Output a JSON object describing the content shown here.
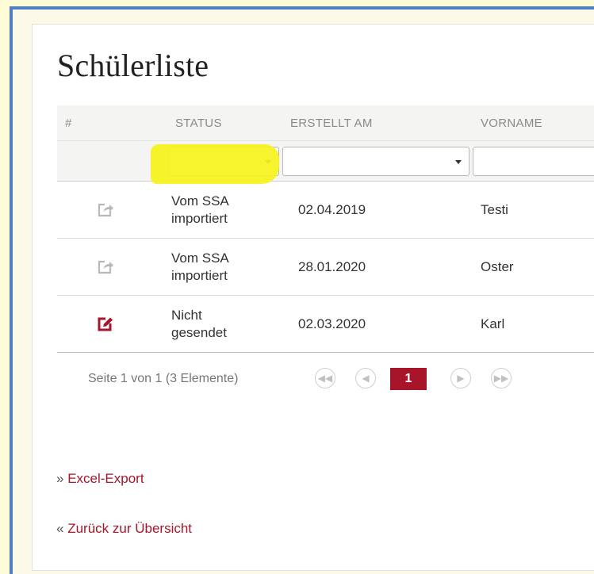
{
  "page": {
    "title": "Schülerliste"
  },
  "table": {
    "columns": [
      "#",
      "STATUS",
      "ERSTELLT AM",
      "VORNAME"
    ],
    "rows": [
      {
        "icon": "share-icon",
        "status_line1": "Vom SSA",
        "status_line2": "importiert",
        "created": "02.04.2019",
        "firstname": "Testi"
      },
      {
        "icon": "share-icon",
        "status_line1": "Vom SSA",
        "status_line2": "importiert",
        "created": "28.01.2020",
        "firstname": "Oster"
      },
      {
        "icon": "edit-icon",
        "status_line1": "Nicht",
        "status_line2": "gesendet",
        "created": "02.03.2020",
        "firstname": "Karl"
      }
    ]
  },
  "pager": {
    "info": "Seite 1 von 1 (3 Elemente)",
    "current_page": "1",
    "first_icon": "first-page-icon",
    "prev_icon": "prev-page-icon",
    "next_icon": "next-page-icon",
    "last_icon": "last-page-icon"
  },
  "links": {
    "export_mark": "»",
    "export": "Excel-Export",
    "back_mark": "«",
    "back": "Zurück zur Übersicht"
  },
  "colors": {
    "accent": "#a8142a",
    "frame_border": "#4f7fc0",
    "highlight": "#f6f21a",
    "background": "#fdfbd8"
  }
}
